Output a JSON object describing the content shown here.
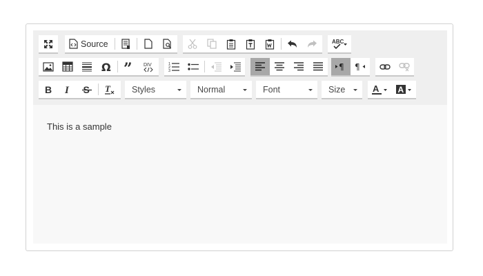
{
  "toolbar": {
    "source_label": "Source",
    "styles_label": "Styles",
    "format_label": "Normal",
    "font_label": "Font",
    "size_label": "Size"
  },
  "content": {
    "text": "This is a sample"
  },
  "icons": {
    "maximize": "maximize-icon",
    "source": "source-icon",
    "templates": "templates-icon",
    "new_page": "new-page-icon",
    "preview": "preview-icon",
    "cut": "cut-icon",
    "copy": "copy-icon",
    "paste": "paste-icon",
    "paste_text": "paste-text-icon",
    "paste_word": "paste-word-icon",
    "undo": "undo-icon",
    "redo": "redo-icon",
    "spellcheck": "spellcheck-icon",
    "image": "image-icon",
    "table": "table-icon",
    "horizontal_line": "horizontal-line-icon",
    "special_char": "special-char-icon",
    "blockquote": "blockquote-icon",
    "div": "div-icon",
    "numbered_list": "numbered-list-icon",
    "bulleted_list": "bulleted-list-icon",
    "outdent": "outdent-icon",
    "indent": "indent-icon",
    "align_left": "align-left-icon",
    "align_center": "align-center-icon",
    "align_right": "align-right-icon",
    "justify": "justify-icon",
    "ltr": "ltr-icon",
    "rtl": "rtl-icon",
    "link": "link-icon",
    "unlink": "unlink-icon",
    "bold": "bold-icon",
    "italic": "italic-icon",
    "strike": "strikethrough-icon",
    "remove_format": "remove-format-icon",
    "text_color": "text-color-icon",
    "bg_color": "background-color-icon"
  },
  "colors": {
    "toolbar_bg": "#efefef",
    "content_bg": "#f8f8f8",
    "active_button": "#a8a8a8"
  }
}
